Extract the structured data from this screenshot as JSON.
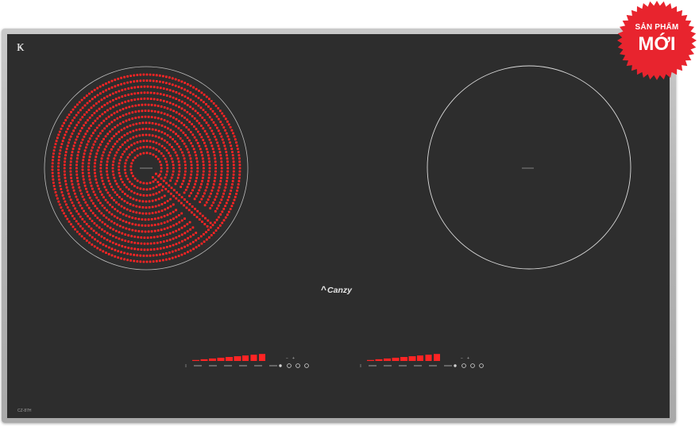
{
  "brand": {
    "logo_text": "Canzy",
    "mark_icon": "brand-k-mark",
    "model": "CZ-87H"
  },
  "badge": {
    "line1": "SẢN PHẨM",
    "line2": "MỚI",
    "color": "#e8242e"
  },
  "colors": {
    "glass": "#2d2d2d",
    "heating_element": "#ff2424",
    "frame": "#b8b8b8",
    "zone_outline": "#e0e0e0"
  },
  "zones": [
    {
      "id": "left",
      "type": "radiant",
      "state": "heating"
    },
    {
      "id": "right",
      "type": "induction",
      "state": "off"
    }
  ],
  "controls": [
    {
      "id": "left",
      "power_level_bars": 9,
      "lit_bars": 9
    },
    {
      "id": "right",
      "power_level_bars": 9,
      "lit_bars": 9
    }
  ]
}
